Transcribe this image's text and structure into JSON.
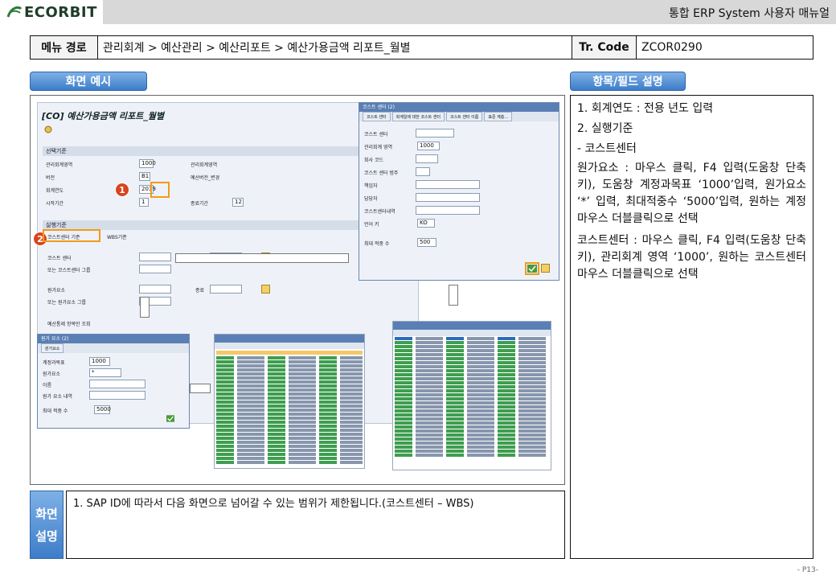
{
  "header": {
    "logo_text": "ECORBIT",
    "doc_title": "통합 ERP System 사용자 매뉴얼"
  },
  "menu": {
    "path_label": "메뉴 경로",
    "path": "관리회계 > 예산관리 > 예산리포트 > 예산가용금액 리포트_월별",
    "tr_label": "Tr. Code",
    "tr_code": "ZCOR0290"
  },
  "sections": {
    "screen_example": "화면 예시",
    "field_desc": "항목/필드 설명"
  },
  "field_desc": {
    "item1": "1.  회계연도 : 전용 년도 입력",
    "item2": "2.  실행기준",
    "item2_sub": " - 코스트센터",
    "para1": "원가요소 : 마우스 클릭, F4 입력(도움창 단축키), 도움창 계정과목표 ‘1000’입력, 원가요소 ‘*’ 입력, 최대적중수 ‘5000’입력, 원하는 계정 마우스 더블클릭으로 선택",
    "para2": "코스트센터 : 마우스 클릭, F4 입력(도움창 단축키), 관리회계 영역 ‘1000’, 원하는 코스트센터 마우스 더블클릭으로 선택"
  },
  "explain": {
    "tag_line1": "화면",
    "tag_line2": "설명",
    "text": "1.  SAP ID에 따라서 다음 화면으로 넘어갈 수 있는 범위가 제한됩니다.(코스트센터 – WBS)"
  },
  "page_number": "- P13-",
  "sap": {
    "title": "[CO] 예산가용금액 리포트_월별",
    "group_select": "선택기준",
    "labels": {
      "co_area": "관리회계영역",
      "version": "버전",
      "fiscal_year": "회계연도",
      "start_period": "시작기간",
      "end_period": "종료기간",
      "co_area_name": "관리회계영역",
      "version_name": "예산버전_변경"
    },
    "values": {
      "co_area": "1000",
      "version": "B1",
      "fiscal_year": "2019",
      "start_period": "1",
      "end_period": "12"
    },
    "group_exec": "실행기준",
    "radio_cc": "코스트센터 기준",
    "radio_wbs": "WBS기준",
    "exec_labels": {
      "cost_center": "코스트 센터",
      "cc_group": "또는 코스트센터 그룹",
      "cost_element": "원가요소",
      "ce_group": "또는 원가요소 그룹",
      "to": "종료"
    },
    "checkbox": "예산통제 항목만 조회",
    "badge1": "1",
    "badge2": "2"
  },
  "popup_cc": {
    "title": "코스트 센터 (2)",
    "tabs": [
      "코스트 센터",
      "회계일에 대한 코스트 센터",
      "코스트 센터 이름",
      "표준 계층..."
    ],
    "fields": [
      "코스트 센터",
      "관리회계 영역",
      "회사 코드",
      "코스트 센터 범주",
      "책임자",
      "담당자",
      "코스트센터내역",
      "언어 키",
      "최대 적중 수"
    ],
    "values": {
      "co_area": "1000",
      "lang": "KO",
      "max_hits": "500"
    }
  },
  "popup_ce": {
    "title": "원가 요소 (2)",
    "tab": "원가요소",
    "fields": [
      "계정과목표",
      "원가요소",
      "이름",
      "원가 요소 내역",
      "최대 적중 수"
    ],
    "values": {
      "chart": "1000",
      "ce": "*",
      "max_hits": "5000"
    }
  },
  "colors": {
    "accent": "#3d7dc9",
    "highlight": "#f39a1a",
    "badge": "#d9441f"
  }
}
